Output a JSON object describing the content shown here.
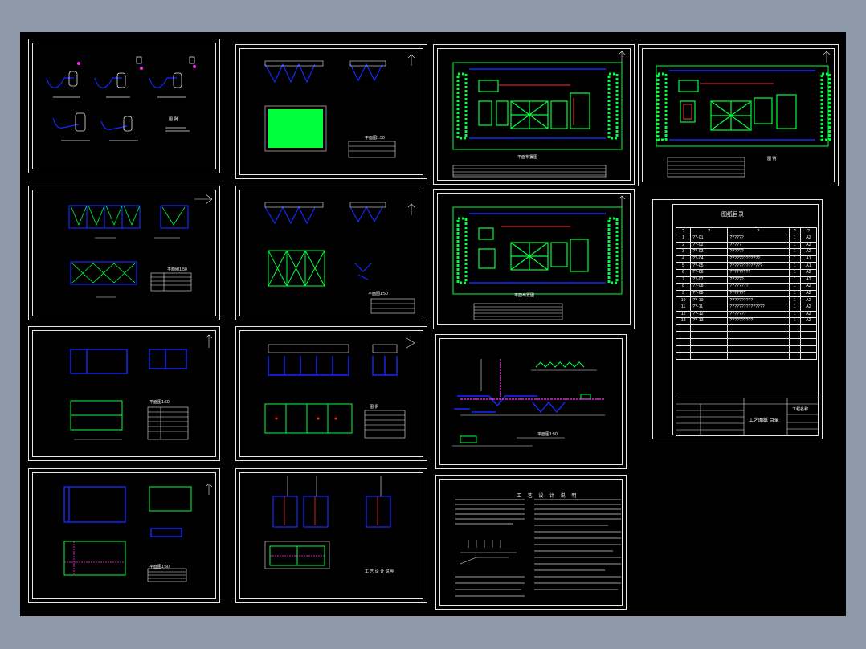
{
  "app": {
    "title": "工艺图纸 目录"
  },
  "colors": {
    "background": "#8e9aaa",
    "canvas": "#000000",
    "line": "#e8e8e8",
    "blue": "#1428ff",
    "green": "#00ff3c",
    "magenta": "#ff30ff",
    "yellow": "#ffff40"
  },
  "icons": [
    "north-arrow-icon"
  ],
  "sheets": [
    {
      "id": "sheet-1",
      "caption": "图 例"
    },
    {
      "id": "sheet-2",
      "caption": "平面图1:50"
    },
    {
      "id": "sheet-3",
      "caption": "平面布置图"
    },
    {
      "id": "sheet-4",
      "caption": "图 例"
    },
    {
      "id": "sheet-5",
      "caption": "平面图1:50"
    },
    {
      "id": "sheet-6",
      "caption": "平面图1:50"
    },
    {
      "id": "sheet-7",
      "caption": "平面布置图"
    },
    {
      "id": "sheet-8",
      "caption": "平面图1:50"
    },
    {
      "id": "sheet-9",
      "caption": "平面图1:50"
    },
    {
      "id": "sheet-10",
      "caption": "图 例"
    },
    {
      "id": "sheet-11",
      "caption": "平面图1:50"
    },
    {
      "id": "sheet-12",
      "caption": "平面图1:50"
    },
    {
      "id": "sheet-13",
      "caption": "工 艺 设 计 说 明"
    }
  ],
  "index": {
    "title": "图纸目录",
    "headers": [
      "?",
      "?",
      "?",
      "?",
      "?",
      "?"
    ],
    "rows": [
      {
        "no": "1",
        "code": "??-01",
        "name": "??????",
        "num": "1",
        "size": "A2"
      },
      {
        "no": "2",
        "code": "??-02",
        "name": "?????",
        "num": "1",
        "size": "A2"
      },
      {
        "no": "3",
        "code": "??-03",
        "name": "??????",
        "num": "1",
        "size": "A2"
      },
      {
        "no": "4",
        "code": "??-04",
        "name": "?????????????",
        "num": "1",
        "size": "A1"
      },
      {
        "no": "5",
        "code": "??-05",
        "name": "??????????????",
        "num": "1",
        "size": "A1"
      },
      {
        "no": "6",
        "code": "??-06",
        "name": "?????????",
        "num": "1",
        "size": "A2"
      },
      {
        "no": "7",
        "code": "??-07",
        "name": "??????",
        "num": "1",
        "size": "A2"
      },
      {
        "no": "8",
        "code": "??-08",
        "name": "????????",
        "num": "1",
        "size": "A2"
      },
      {
        "no": "9",
        "code": "??-09",
        "name": "???????",
        "num": "1",
        "size": "A2"
      },
      {
        "no": "10",
        "code": "??-10",
        "name": "??????????",
        "num": "1",
        "size": "A2"
      },
      {
        "no": "11",
        "code": "??-11",
        "name": "???????????????",
        "num": "1",
        "size": "A2"
      },
      {
        "no": "12",
        "code": "??-12",
        "name": "???????",
        "num": "1",
        "size": "A2"
      },
      {
        "no": "13",
        "code": "??-13",
        "name": "??????????",
        "num": "1",
        "size": "A2"
      }
    ],
    "titleblock": {
      "drawing": "工艺图纸 目录",
      "stamp": "工程名称"
    }
  }
}
